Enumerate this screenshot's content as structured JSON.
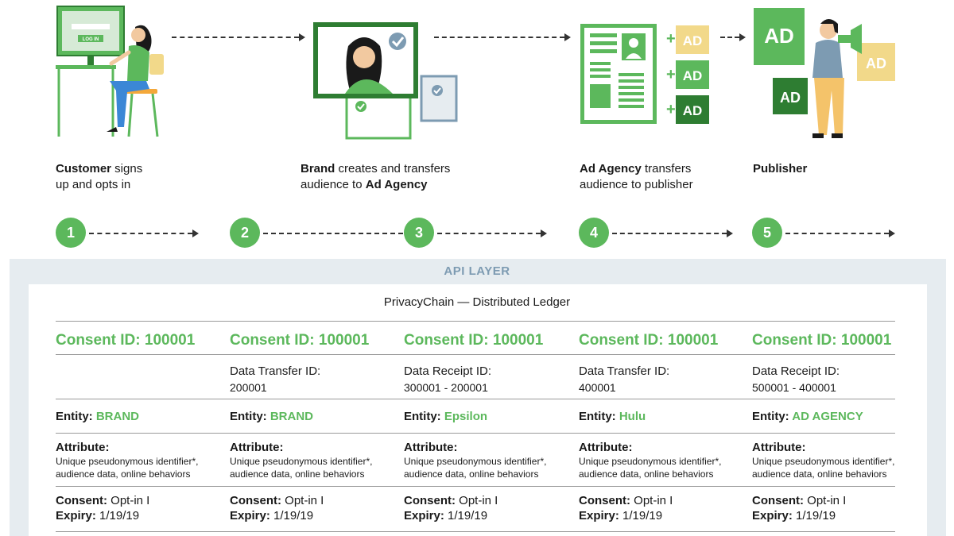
{
  "illustrations": {
    "login_screen_button": "LOG IN",
    "ad_labels": [
      "AD",
      "AD",
      "AD",
      "AD",
      "AD",
      "AD"
    ],
    "icons": [
      "customer-at-computer-icon",
      "brand-profile-check-icon",
      "ad-agency-document-icon",
      "publisher-megaphone-icon"
    ]
  },
  "captions": [
    {
      "bold": "Customer",
      "rest1": " signs",
      "line2": "up and opts in"
    },
    {
      "bold": "Brand",
      "rest1": " creates and transfers",
      "line2a": "audience to ",
      "line2b": "Ad Agency"
    },
    {
      "bold": "Ad Agency",
      "rest1": " transfers",
      "line2": "audience to publisher"
    },
    {
      "bold": "Publisher"
    }
  ],
  "steps": [
    "1",
    "2",
    "3",
    "4",
    "5"
  ],
  "api_layer": "API LAYER",
  "ledger_title": "PrivacyChain — Distributed Ledger",
  "columns": [
    {
      "consent_id": "Consent ID: 100001",
      "transfer_label": "",
      "transfer_value": "",
      "entity_label": "Entity: ",
      "entity_value": "BRAND",
      "attribute_label": "Attribute:",
      "attribute_value": "Unique pseudonymous identifier*, audience data, online behaviors",
      "consent_label": "Consent:",
      "consent_value": " Opt-in I",
      "expiry_label": "Expiry:",
      "expiry_value": " 1/19/19"
    },
    {
      "consent_id": "Consent ID: 100001",
      "transfer_label": "Data Transfer ID:",
      "transfer_value": "200001",
      "entity_label": "Entity: ",
      "entity_value": "BRAND",
      "attribute_label": "Attribute:",
      "attribute_value": "Unique pseudonymous identifier*, audience data, online behaviors",
      "consent_label": "Consent:",
      "consent_value": " Opt-in I",
      "expiry_label": "Expiry:",
      "expiry_value": " 1/19/19"
    },
    {
      "consent_id": "Consent ID: 100001",
      "transfer_label": "Data Receipt ID:",
      "transfer_value": "300001 - 200001",
      "entity_label": "Entity: ",
      "entity_value": "Epsilon",
      "attribute_label": "Attribute:",
      "attribute_value": "Unique pseudonymous identifier*, audience data, online behaviors",
      "consent_label": "Consent:",
      "consent_value": " Opt-in I",
      "expiry_label": "Expiry:",
      "expiry_value": " 1/19/19"
    },
    {
      "consent_id": "Consent ID: 100001",
      "transfer_label": "Data Transfer ID:",
      "transfer_value": "400001",
      "entity_label": "Entity: ",
      "entity_value": "Hulu",
      "attribute_label": "Attribute:",
      "attribute_value": "Unique pseudonymous identifier*, audience data, online behaviors",
      "consent_label": "Consent:",
      "consent_value": " Opt-in I",
      "expiry_label": "Expiry:",
      "expiry_value": " 1/19/19"
    },
    {
      "consent_id": "Consent ID: 100001",
      "transfer_label": "Data Receipt ID:",
      "transfer_value": "500001 - 400001",
      "entity_label": "Entity: ",
      "entity_value": "AD AGENCY",
      "attribute_label": "Attribute:",
      "attribute_value": "Unique pseudonymous identifier*, audience data, online behaviors",
      "consent_label": "Consent:",
      "consent_value": " Opt-in I",
      "expiry_label": "Expiry:",
      "expiry_value": " 1/19/19"
    }
  ],
  "colors": {
    "accent_green": "#5cb85c",
    "dark_green": "#2e7d32",
    "pale_yellow": "#f2d98a",
    "api_band": "#e6ecf0",
    "api_text": "#7d9bb2"
  }
}
